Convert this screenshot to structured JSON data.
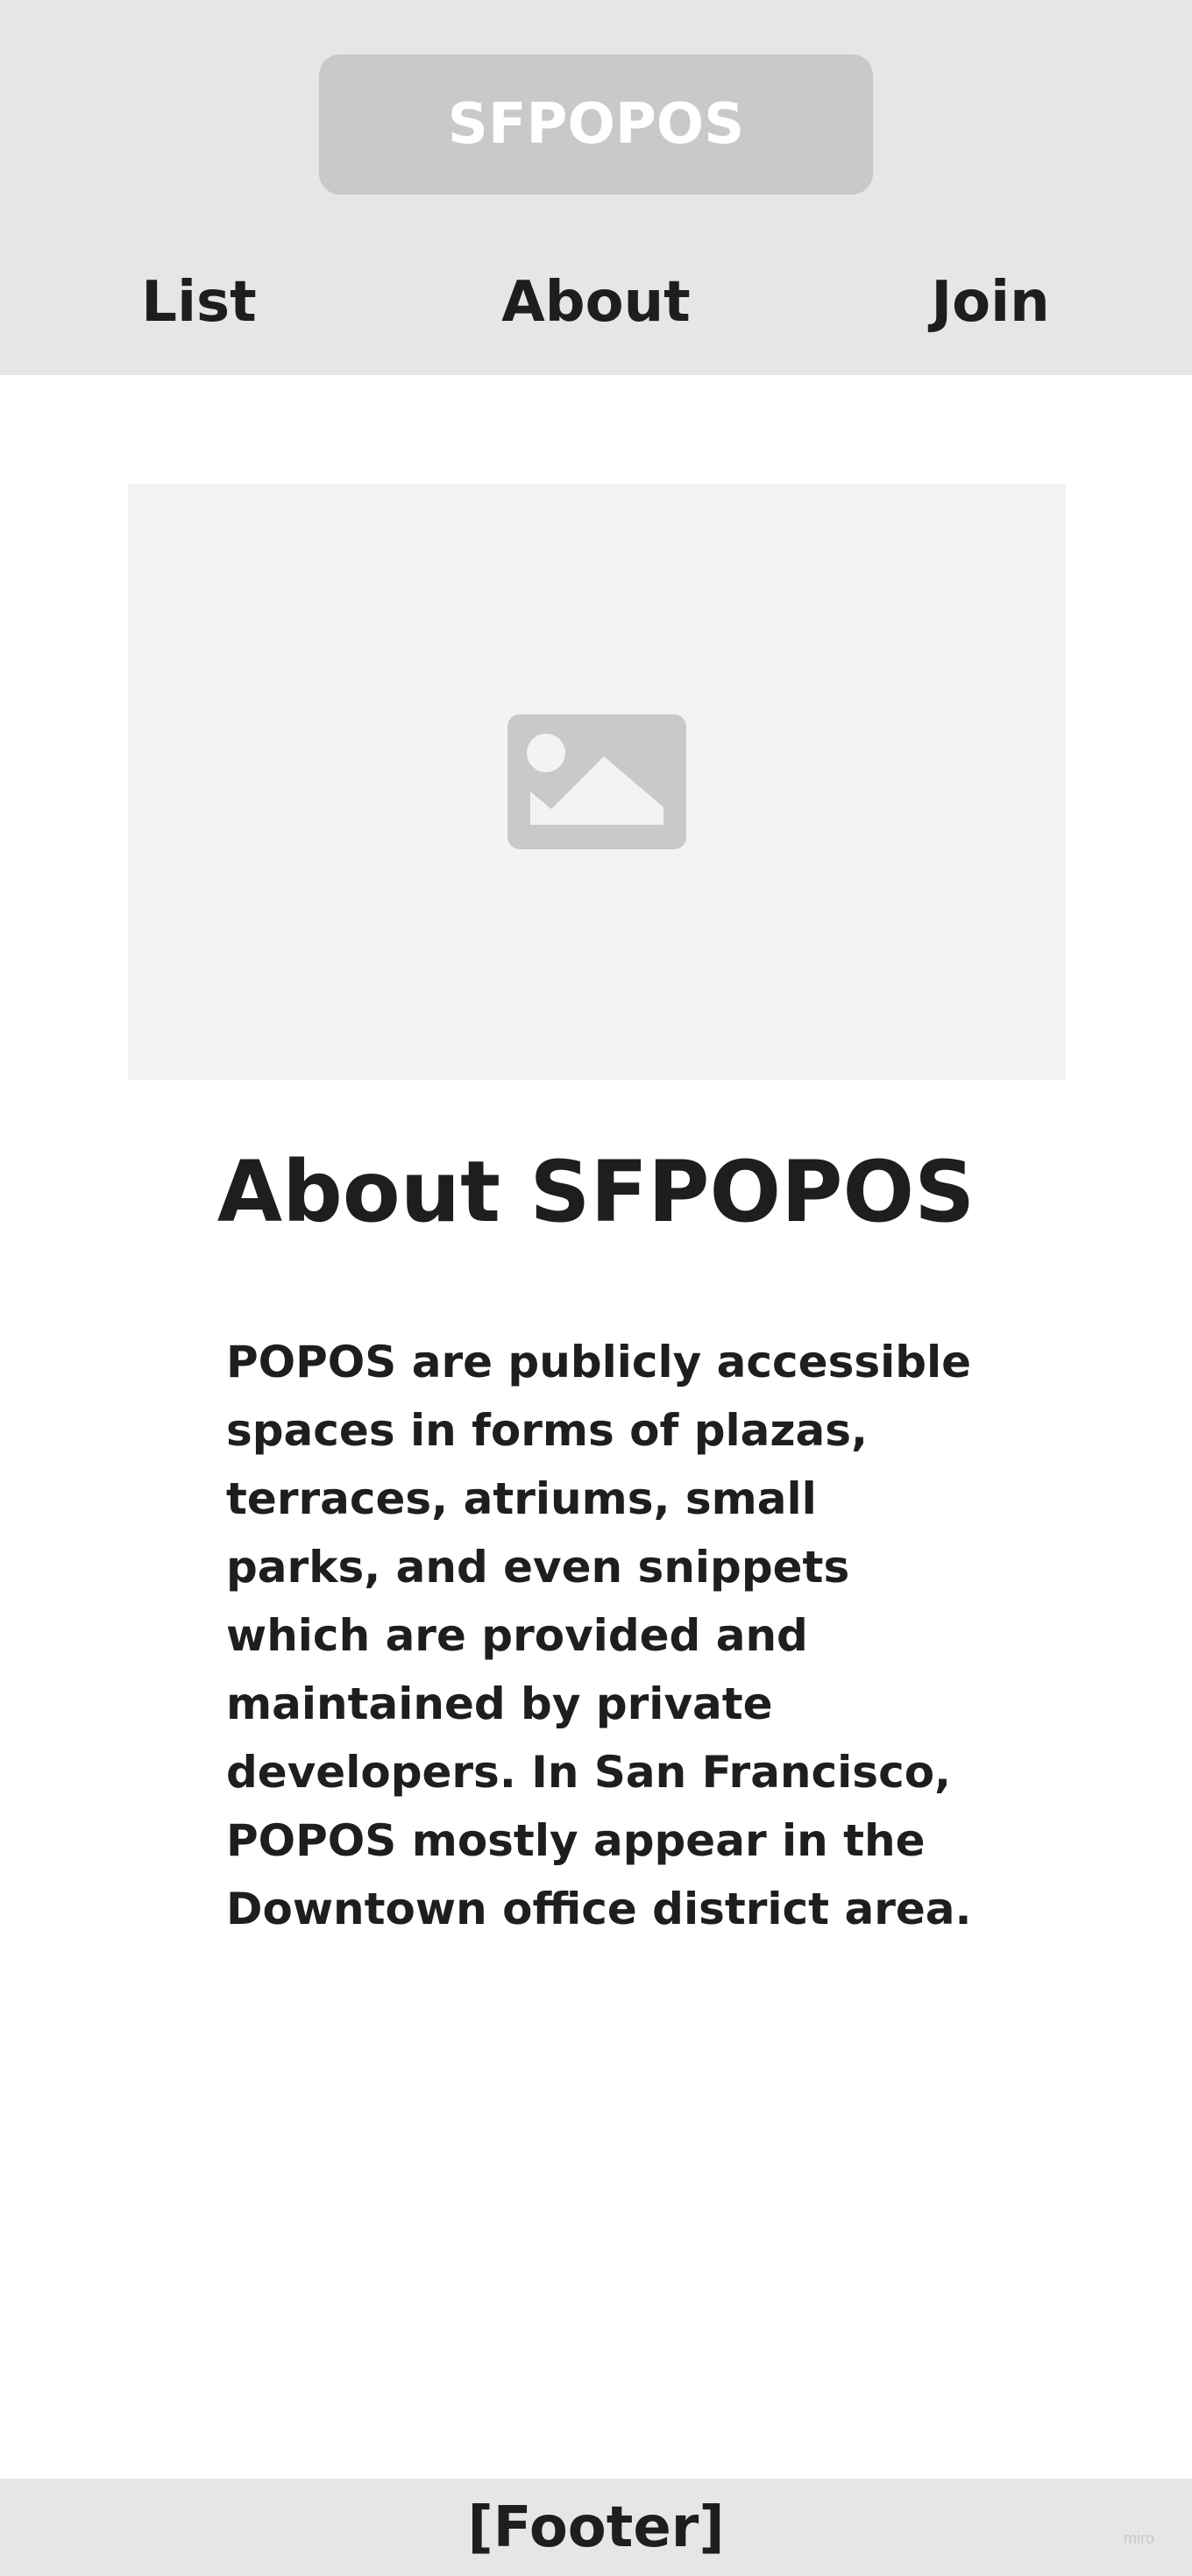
{
  "header": {
    "logo_text": "SFPOPOS",
    "nav": [
      {
        "label": "List"
      },
      {
        "label": "About"
      },
      {
        "label": "Join"
      }
    ]
  },
  "main": {
    "image_icon": "image-placeholder-icon",
    "title": "About SFPOPOS",
    "body": "POPOS are publicly accessible spaces in forms of plazas, terraces, atriums, small parks, and even snippets which are provided and maintained by private developers. In San Francisco, POPOS mostly appear in the Downtown office district area."
  },
  "footer": {
    "text": "[Footer]"
  },
  "watermark": "miro",
  "colors": {
    "header_bg": "#e6e6e6",
    "logo_bg": "#c9c9c9",
    "image_bg": "#f3f3f3",
    "icon": "#c9c9c9",
    "text": "#1e1e1e"
  }
}
